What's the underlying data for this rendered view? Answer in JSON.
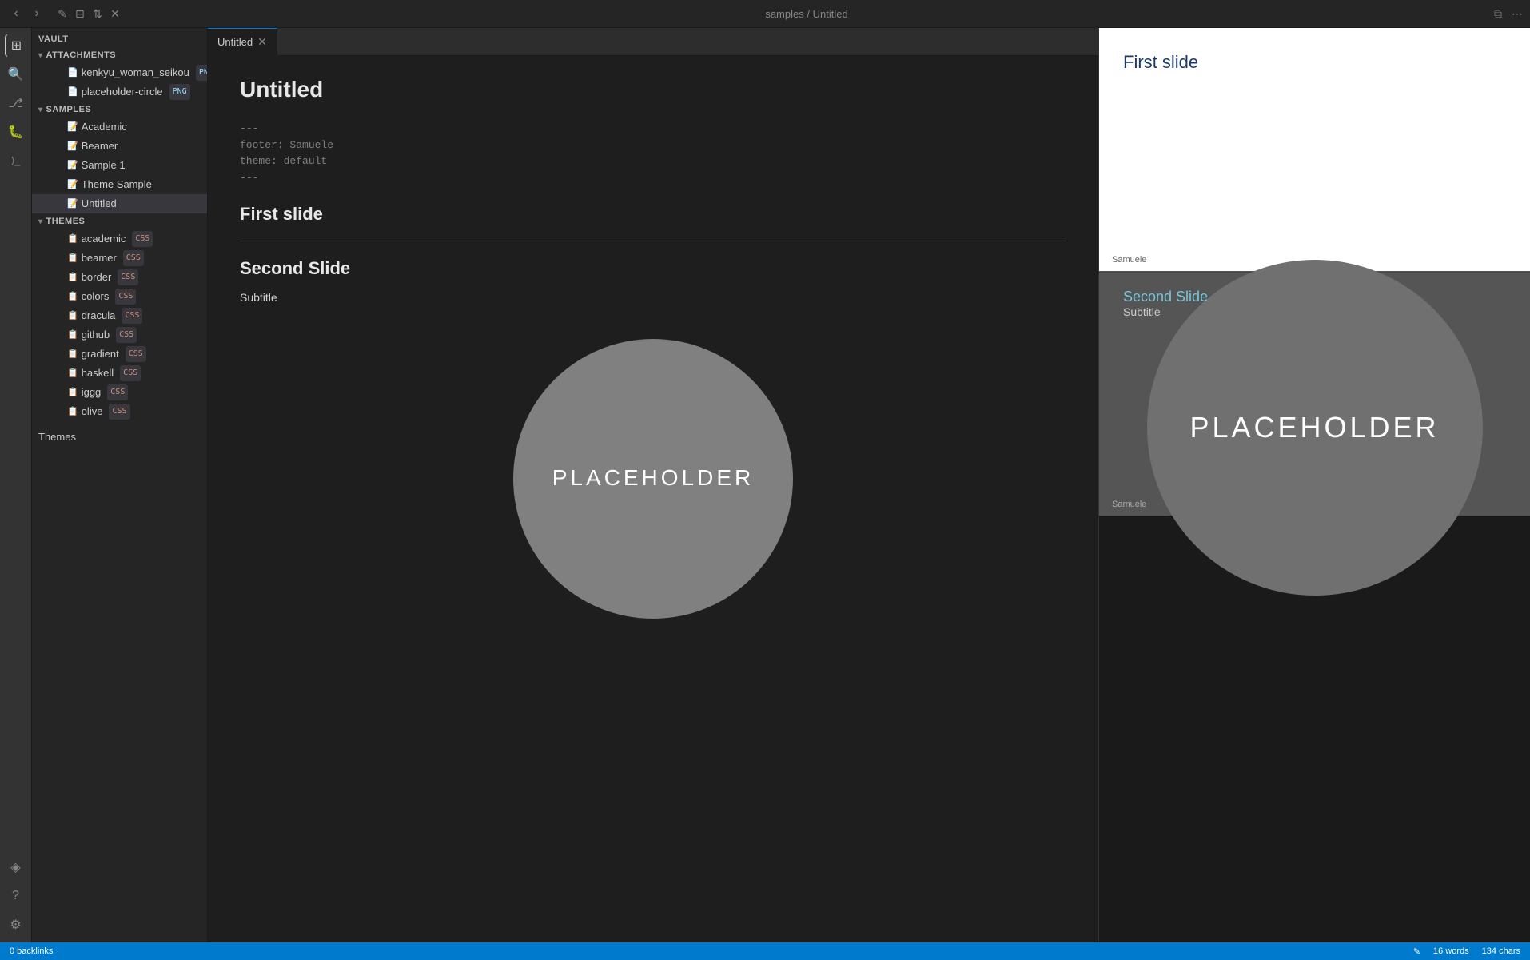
{
  "topbar": {
    "edit_icon": "✎",
    "folder_icon": "📁",
    "sort_icon": "⇅",
    "close_icon": "✕",
    "breadcrumb_separator": "/",
    "breadcrumb_parent": "samples",
    "breadcrumb_current": "Untitled",
    "split_icon": "⧉",
    "more_icon": "⋯",
    "back_icon": "‹",
    "forward_icon": "›"
  },
  "activity_bar": {
    "icons": [
      "⊞",
      "🔍",
      "⎇",
      "🐛",
      "⟩_",
      "◈"
    ]
  },
  "sidebar": {
    "vault_label": "vault",
    "attachments": {
      "label": "attachments",
      "files": [
        {
          "name": "kenkyu_woman_seikou",
          "badge": "PNG"
        },
        {
          "name": "placeholder-circle",
          "badge": "PNG"
        }
      ]
    },
    "samples": {
      "label": "samples",
      "items": [
        {
          "name": "Academic"
        },
        {
          "name": "Beamer"
        },
        {
          "name": "Sample 1"
        },
        {
          "name": "Theme Sample"
        },
        {
          "name": "Untitled",
          "active": true
        }
      ]
    },
    "themes": {
      "label": "themes",
      "items": [
        {
          "name": "academic",
          "badge": "CSS"
        },
        {
          "name": "beamer",
          "badge": "CSS"
        },
        {
          "name": "border",
          "badge": "CSS"
        },
        {
          "name": "colors",
          "badge": "CSS"
        },
        {
          "name": "dracula",
          "badge": "CSS"
        },
        {
          "name": "github",
          "badge": "CSS"
        },
        {
          "name": "gradient",
          "badge": "CSS"
        },
        {
          "name": "haskell",
          "badge": "CSS"
        },
        {
          "name": "iggg",
          "badge": "CSS"
        },
        {
          "name": "olive",
          "badge": "CSS"
        }
      ]
    },
    "themes_section": "Themes"
  },
  "editor": {
    "tab_label": "Untitled",
    "doc_title": "Untitled",
    "frontmatter_lines": [
      "---",
      "footer: Samuele",
      "theme: default",
      "---"
    ],
    "slide1_title": "First slide",
    "divider": true,
    "slide2_title": "Second Slide",
    "slide2_subtitle": "Subtitle",
    "placeholder_text": "PLACEHOLDER"
  },
  "preview": {
    "slide1": {
      "title": "First slide",
      "footer": "Samuele"
    },
    "slide2": {
      "title": "Second Slide",
      "subtitle": "Subtitle",
      "placeholder": "PLACEHOLDER",
      "footer": "Samuele"
    }
  },
  "statusbar": {
    "backlinks": "0 backlinks",
    "words": "16 words",
    "chars": "134 chars",
    "edit_icon": "✎"
  }
}
